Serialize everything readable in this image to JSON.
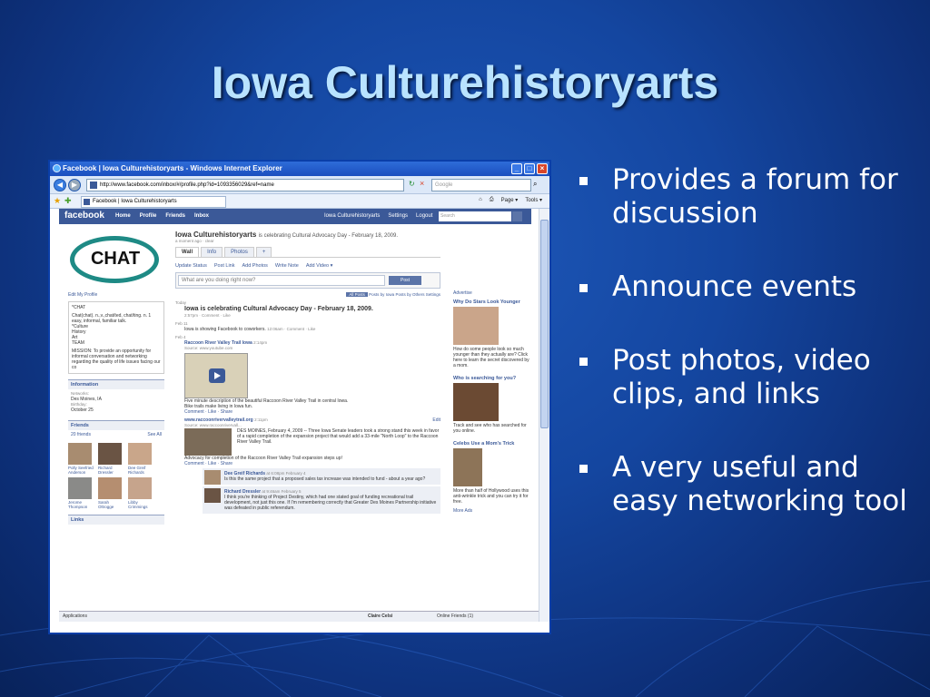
{
  "slide": {
    "title": "Iowa Culturehistoryarts",
    "bullets": [
      "Provides a forum for discussion",
      "Announce events",
      "Post photos, video clips, and links",
      "A very useful and easy networking tool"
    ]
  },
  "browser": {
    "window_title": "Facebook | Iowa Culturehistoryarts - Windows Internet Explorer",
    "address": "http://www.facebook.com/inbox/#/profile.php?id=1093356029&ref=name",
    "search_placeholder": "Google",
    "tab_title": "Facebook | Iowa Culturehistoryarts",
    "tools": [
      "Page ▾",
      "Tools ▾"
    ]
  },
  "facebook": {
    "logo": "facebook",
    "nav": [
      "Home",
      "Profile",
      "Friends",
      "Inbox"
    ],
    "right_nav": [
      "Iowa Culturehistoryarts",
      "Settings",
      "Logout"
    ],
    "search_placeholder": "Search",
    "profile_image_text": "CHAT",
    "edit_profile": "Edit My Profile",
    "about": {
      "title": "*CHAT",
      "definition": "Chat(chat). n.,v.,chat/ted, chat/ting. n. 1 easy, informal, familiar talk.",
      "lines": [
        "*Culture",
        "History",
        "Art",
        "TEAM"
      ],
      "mission": "MISSION: To provide an opportunity for informal conversation and networking regarding the quality of life issues facing our co"
    },
    "information": {
      "heading": "Information",
      "networks_label": "Networks:",
      "networks_value": "Des Moines, IA",
      "birthday_label": "Birthday:",
      "birthday_value": "October 25"
    },
    "friends": {
      "heading": "Friends",
      "count": "20 friends",
      "see_all": "See All",
      "people": [
        "Polly Seefried Anderson",
        "Richard Dressler",
        "Dee Greif Richards",
        "Jerome Thompson",
        "Sarah Oltrogge",
        "Libby Crimmings"
      ]
    },
    "links_heading": "Links",
    "profile": {
      "name": "Iowa Culturehistoryarts",
      "status": "is celebrating Cultural Advocacy Day - February 18, 2009.",
      "status_meta": "a moment ago · clear",
      "tabs": [
        "Wall",
        "Info",
        "Photos",
        "+"
      ],
      "actions": [
        "Update Status",
        "Post Link",
        "Add Photos",
        "Write Note",
        "Add Video ▾"
      ],
      "composer_placeholder": "What are you doing right now?",
      "post_button": "Post",
      "filters": [
        "All Posts",
        "Posts by Iowa",
        "Posts by Others",
        "Settings"
      ]
    },
    "wall": {
      "today": "Today",
      "story1": "Iowa is celebrating Cultural Advocacy Day - February 18, 2009.",
      "story1_meta": "2:57pm · Comment · Like",
      "feb11": "Feb 11",
      "story2": "Iowa is showing Facebook to coworkers.",
      "story2_meta": "12:06am · Comment · Like",
      "feb4": "Feb 4",
      "video_title": "Raccoon River Valley Trail Iowa",
      "video_time": "2:14pm",
      "video_source": "Source: www.youtube.com",
      "video_desc": "Five minute description of the beautiful Raccoon River Valley Trail in central Iowa.",
      "video_quote": "Bike trails make living in Iowa fun.",
      "video_meta": "Comment · Like · Share",
      "link_title": "www.raccoonrivervalleytrail.org",
      "link_time": "2:11pm",
      "link_source": "Source: www.raccoonrivervall...",
      "link_desc": "DES MOINES, February 4, 2009 -- Three Iowa Senate leaders took a strong stand this week in favor of a rapid completion of the expansion project that would add a 33-mile \"North Loop\" to the Raccoon River Valley Trail.",
      "link_quote": "Advocacy for completion of the Raccoon River Valley Trail expansion steps up!",
      "link_meta": "Comment · Like · Share",
      "edit": "Edit",
      "comments": [
        {
          "name": "Dee Greif Richards",
          "time": "at 6:08pm February 4",
          "text": "Is this the same project that a proposed sales tax increase was intended to fund - about a year ago?"
        },
        {
          "name": "Richard Dressler",
          "time": "at 9:46am February 5",
          "text": "I think you're thinking of Project Destiny, which had one stated goal of funding recreational trail development, not just this one. If I'm remembering correctly that Greater Des Moines Partnership initiative was defeated in public referendum."
        }
      ]
    },
    "ads": {
      "advertise": "Advertise",
      "items": [
        {
          "title": "Why Do Stars Look Younger",
          "text": "How do some people look so much younger than they actually are? Click here to learn the secret discovered by a mom."
        },
        {
          "title": "Who is searching for you?",
          "text": "Track and see who has searched for you online."
        },
        {
          "title": "Celebs Use a Mom's Trick",
          "text": "More than half of Hollywood uses this anti-wrinkle trick and you can try it for free."
        }
      ],
      "more": "More Ads"
    },
    "chatbar": {
      "applications": "Applications",
      "user": "Claire Celsi",
      "online": "Online Friends (1)"
    }
  },
  "colors": {
    "slide_bg": "#1446a0",
    "title": "#b9e3ff",
    "facebook_blue": "#3b5998"
  }
}
